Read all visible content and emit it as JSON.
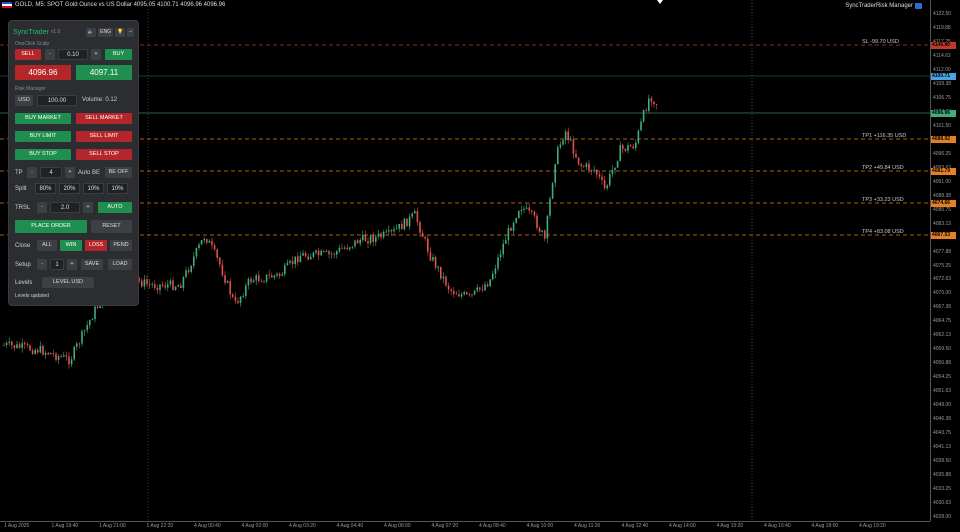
{
  "header": {
    "title": "GOLD, M5: SPOT Gold Ounce vs US Dollar  4095.05 4100.71 4096.96 4096.96",
    "ea_name": "SyncTraderRisk Manager"
  },
  "colors": {
    "background": "#000000",
    "bull_candle": "#3fae7a",
    "bear_candle": "#e0524f",
    "sl_line": "#c0392b",
    "tp_line": "#e67e22",
    "bid_line": "#6fbf8a"
  },
  "price_axis": {
    "ticks": [
      "4122.50",
      "4119.88",
      "4117.25",
      "4114.63",
      "4112.00",
      "4109.38",
      "4106.75",
      "4104.13",
      "4101.50",
      "4098.88",
      "4096.25",
      "4093.63",
      "4091.00",
      "4088.38",
      "4085.75",
      "4083.13",
      "4080.50",
      "4077.88",
      "4075.25",
      "4072.63",
      "4070.00",
      "4067.38",
      "4064.75",
      "4062.13",
      "4059.50",
      "4056.88",
      "4054.25",
      "4051.63",
      "4049.00",
      "4046.38",
      "4043.75",
      "4041.13",
      "4038.50",
      "4035.88",
      "4033.25",
      "4030.63",
      "4028.00"
    ],
    "tags": [
      {
        "name": "sl-price-tag",
        "text": "4146.90",
        "color": "#c0392b"
      },
      {
        "name": "ask-price-tag",
        "text": "4100.71",
        "color": "#4aa3df"
      },
      {
        "name": "bid-price-tag",
        "text": "4096.96",
        "color": "#3fae7a"
      },
      {
        "name": "tp1-price-tag",
        "text": "4088.92",
        "color": "#e67e22"
      },
      {
        "name": "tp2-price-tag",
        "text": "4081.79",
        "color": "#e67e22"
      },
      {
        "name": "tp3-price-tag",
        "text": "4074.66",
        "color": "#e67e22"
      },
      {
        "name": "tp4-price-tag",
        "text": "4067.53",
        "color": "#e67e22"
      }
    ]
  },
  "time_axis": {
    "ticks": [
      "1 Aug 2025",
      "1 Aug 19:40",
      "1 Aug 21:00",
      "1 Aug 22:20",
      "4 Aug 00:40",
      "4 Aug 02:00",
      "4 Aug 03:20",
      "4 Aug 04:40",
      "4 Aug 06:00",
      "4 Aug 07:20",
      "4 Aug 08:40",
      "4 Aug 10:00",
      "4 Aug 11:20",
      "4 Aug 12:40",
      "4 Aug 14:00",
      "4 Aug 15:20",
      "4 Aug 16:40",
      "4 Aug 18:00",
      "4 Aug 19:20"
    ]
  },
  "levels": [
    {
      "label": "SL -99.70 USD"
    },
    {
      "label": "TP1 +116.35 USD"
    },
    {
      "label": "TP2 +49.84 USD"
    },
    {
      "label": "TP3 +33.23 USD"
    },
    {
      "label": "TP4 +83.08 USD"
    }
  ],
  "panel": {
    "title": "SyncTrader",
    "version": "v1.0",
    "sound_icon": "speaker-icon",
    "language": "ENG",
    "theme_icon": "bulb-icon",
    "minimize": "–",
    "oneclick_label": "OneClick Scalp",
    "sell_label": "SELL",
    "minus": "-",
    "plus": "+",
    "lot_value": "0.10",
    "buy_label": "BUY",
    "bid_price": "4096.96",
    "ask_price": "4097.11",
    "risk_label": "Risk Manager",
    "currency": "USD",
    "risk_value": "100.00",
    "volume_text": "Volume: 0.12",
    "buy_market": "BUY MARKET",
    "sell_market": "SELL MARKET",
    "buy_limit": "BUY LIMIT",
    "sell_limit": "SELL LIMIT",
    "buy_stop": "BUY STOP",
    "sell_stop": "SELL STOP",
    "tp_label": "TP",
    "tp_count": "4",
    "auto_be": "Auto BE",
    "be_off": "BE OFF",
    "split_label": "Split",
    "splits": [
      "80%",
      "20%",
      "10%",
      "10%"
    ],
    "trsl_label": "TRSL",
    "trsl_value": "2.0",
    "auto": "AUTO",
    "place_order": "PLACE ORDER",
    "reset": "RESET",
    "close_label": "Close",
    "close_all": "ALL",
    "close_win": "WIN",
    "close_loss": "LOSS",
    "close_pend": "PEND",
    "setup_label": "Setup",
    "setup_value": "1",
    "save": "SAVE",
    "load": "LOAD",
    "levels_label": "Levels",
    "level_usd": "LEVEL USD",
    "status": "Levels updated"
  }
}
